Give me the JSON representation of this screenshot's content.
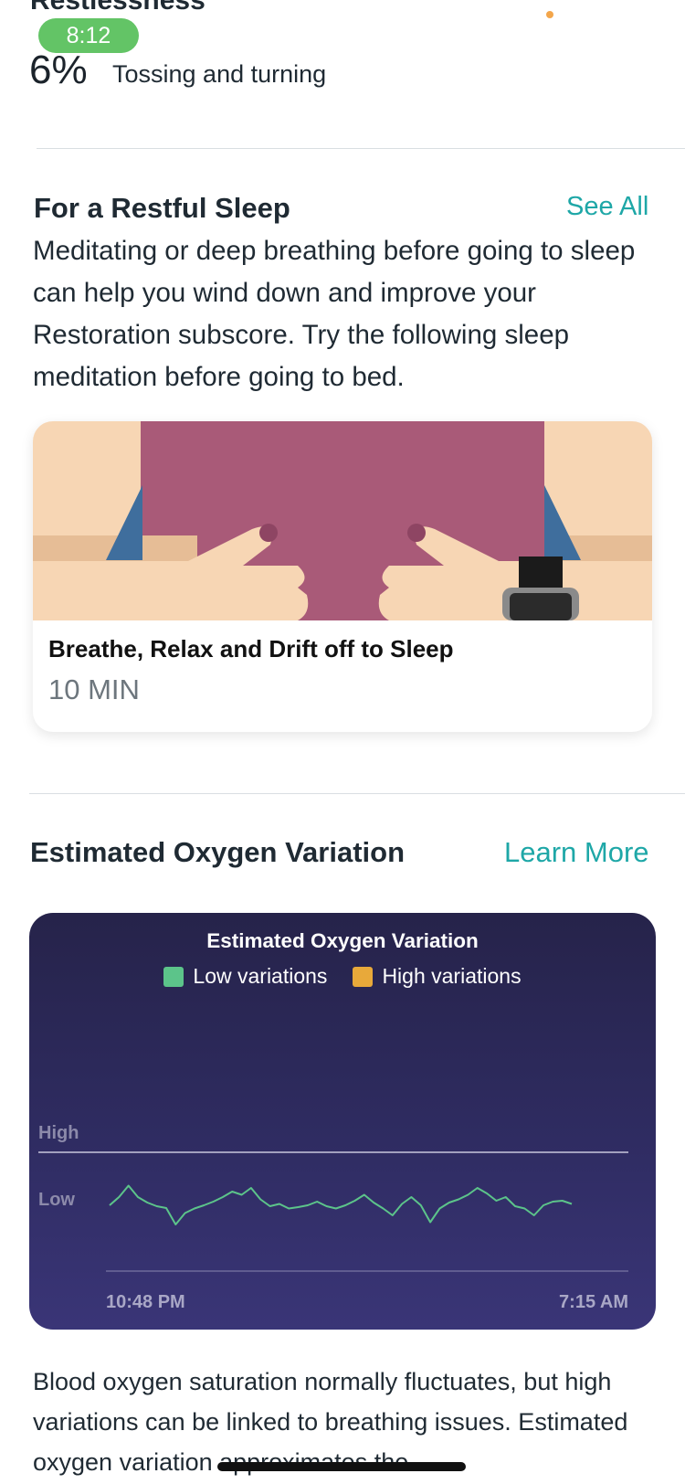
{
  "restlessness": {
    "title": "Restlessness",
    "time_badge": "8:12",
    "percent": "6%",
    "description": "Tossing and turning"
  },
  "restful_sleep": {
    "title": "For a Restful Sleep",
    "see_all": "See All",
    "description": "Meditating or deep breathing before going to sleep can help you wind down and improve your Restoration subscore. Try the following sleep meditation before going to bed.",
    "card": {
      "title": "Breathe, Relax and Drift off to Sleep",
      "duration": "10 MIN"
    }
  },
  "oxygen": {
    "title": "Estimated Oxygen Variation",
    "learn_more": "Learn More",
    "body": "Blood oxygen saturation normally fluctuates, but high variations can be linked to breathing issues. Estimated oxygen variation approximates the"
  },
  "chart_data": {
    "type": "line",
    "title": "Estimated Oxygen Variation",
    "legend": [
      {
        "name": "Low variations",
        "color": "#5cc48a"
      },
      {
        "name": "High variations",
        "color": "#e8a93a"
      }
    ],
    "y_levels": [
      "High",
      "Low"
    ],
    "x_tick_labels": [
      "10:48 PM",
      "7:15 AM"
    ],
    "series": [
      {
        "name": "Low variations",
        "color": "#5cc48a",
        "values": [
          0.12,
          0.3,
          0.55,
          0.3,
          0.18,
          0.1,
          0.06,
          -0.3,
          -0.05,
          0.05,
          0.12,
          0.2,
          0.3,
          0.42,
          0.35,
          0.5,
          0.25,
          0.1,
          0.15,
          0.05,
          0.08,
          0.12,
          0.2,
          0.1,
          0.05,
          0.12,
          0.22,
          0.35,
          0.18,
          0.05,
          -0.1,
          0.15,
          0.3,
          0.12,
          -0.25,
          0.05,
          0.18,
          0.25,
          0.35,
          0.5,
          0.38,
          0.22,
          0.3,
          0.1,
          0.05,
          -0.1,
          0.12,
          0.2,
          0.22,
          0.15
        ]
      }
    ],
    "legend_position": "top-center",
    "grid": false
  }
}
